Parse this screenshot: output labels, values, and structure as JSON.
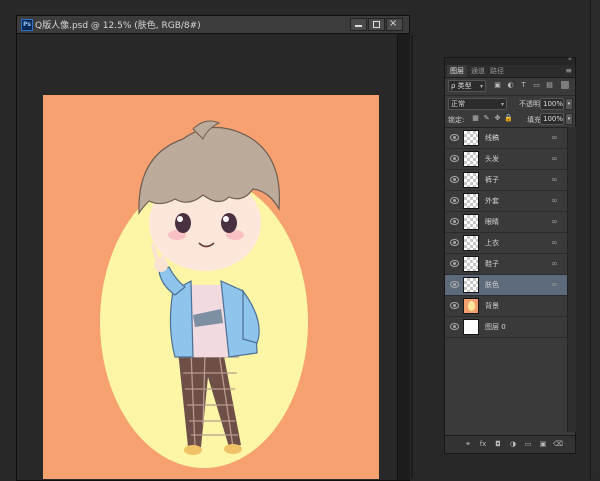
{
  "document": {
    "title": "Q版人像.psd @ 12.5% (肤色, RGB/8#)",
    "app_badge": "Ps"
  },
  "panel": {
    "tabs": [
      "图层",
      "通道",
      "路径"
    ],
    "filter_label": "ρ 类型",
    "blend_mode": "正常",
    "opacity_label": "不透明度:",
    "opacity_value": "100%",
    "lock_label": "锁定:",
    "fill_label": "填充:",
    "fill_value": "100%",
    "layers": [
      {
        "name": "线稿",
        "selected": false
      },
      {
        "name": "头发",
        "selected": false
      },
      {
        "name": "裤子",
        "selected": false
      },
      {
        "name": "外套",
        "selected": false
      },
      {
        "name": "眼睛",
        "selected": false
      },
      {
        "name": "上衣",
        "selected": false
      },
      {
        "name": "鞋子",
        "selected": false
      },
      {
        "name": "肤色",
        "selected": true
      },
      {
        "name": "背景",
        "selected": false
      },
      {
        "name": "图层 0",
        "selected": false
      }
    ]
  },
  "colors": {
    "canvas_bg": "#f6a16f",
    "halo": "#fdf6a6",
    "selected_layer": "#5d6a7b"
  }
}
